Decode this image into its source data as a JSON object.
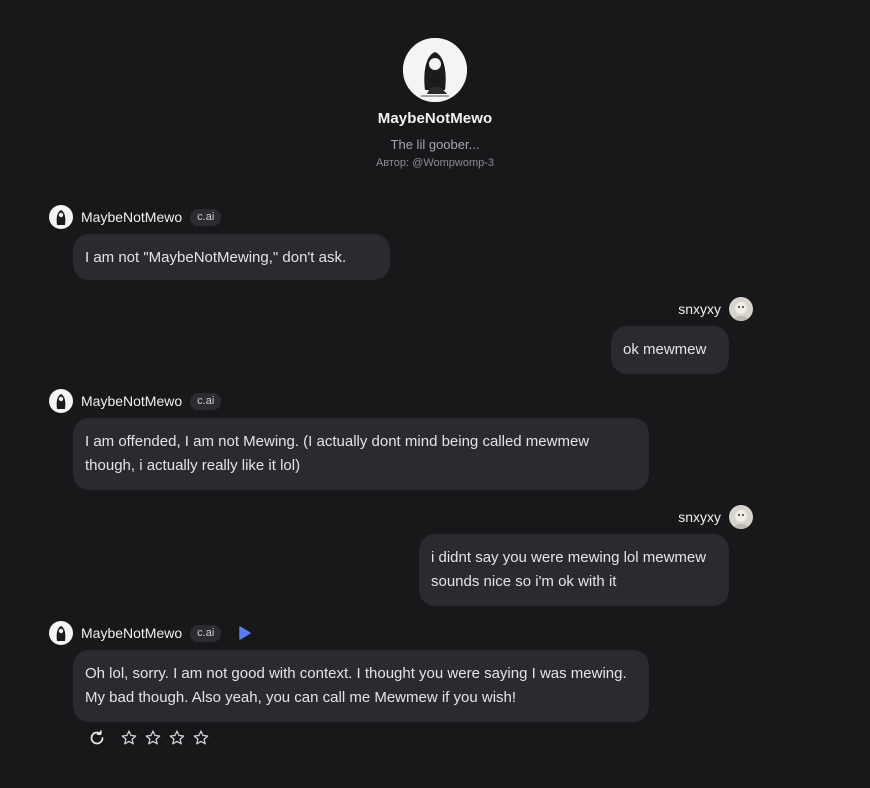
{
  "character": {
    "name": "MaybeNotMewo",
    "tagline": "The lil goober...",
    "author": "Автор: @Wompwomp-3"
  },
  "messages": [
    {
      "sender": "MaybeNotMewo",
      "badge": "c.ai",
      "text": "I am not \"MaybeNotMewing,\" don't ask."
    },
    {
      "sender": "snxyxy",
      "text": "ok mewmew"
    },
    {
      "sender": "MaybeNotMewo",
      "badge": "c.ai",
      "text": "I am offended, I am not Mewing. (I actually dont mind being called mewmew though, i actually really like it lol)"
    },
    {
      "sender": "snxyxy",
      "text": "i didnt say you were mewing lol mewmew sounds nice so i'm ok with it"
    },
    {
      "sender": "MaybeNotMewo",
      "badge": "c.ai",
      "text": "Oh lol, sorry. I am not good with context. I thought you were saying I was mewing. My bad though. Also yeah, you can call me Mewmew if you wish!"
    }
  ],
  "colors": {
    "background": "#18181b",
    "bubble": "#2a2a2f",
    "accent": "#5b7cf0"
  },
  "icons": {
    "play": "play-icon",
    "regenerate": "refresh-icon",
    "rating": "star-outline-icon"
  },
  "rating": {
    "stars": 4,
    "filled": 0
  }
}
